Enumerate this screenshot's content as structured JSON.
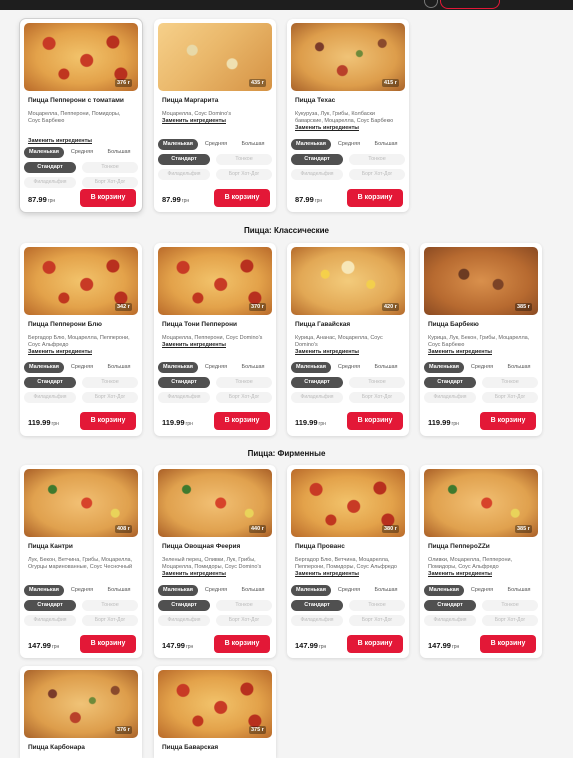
{
  "sections": [
    {
      "title": "",
      "cards": [
        {
          "name": "Пицца Пепперони с томатами",
          "weight": "376 г",
          "ingredients": "Моцарелла, Пепперони, Помидоры, Соус Барбекю",
          "change": "Заменить ингредиенты",
          "price": "87.99",
          "currency": "грн",
          "cart": "В корзину",
          "selected": true
        },
        {
          "name": "Пицца Маргарита",
          "weight": "435 г",
          "ingredients": "Моцарелла, Соус Domino's",
          "change": "Заменить ингредиенты",
          "price": "87.99",
          "currency": "грн",
          "cart": "В корзину"
        },
        {
          "name": "Пицца Техас",
          "weight": "415 г",
          "ingredients": "Кукуруза, Лук, Грибы, Колбаски баварские, Моцарелла, Соус Барбекю",
          "change": "Заменить ингредиенты",
          "price": "87.99",
          "currency": "грн",
          "cart": "В корзину"
        }
      ]
    },
    {
      "title": "Пицца: Классические",
      "cards": [
        {
          "name": "Пицца Пепперони Блю",
          "weight": "342 г",
          "ingredients": "Бергадор Блю, Моцарелла, Пепперони, Соус Альфредо",
          "change": "Заменить ингредиенты",
          "price": "119.99",
          "currency": "грн",
          "cart": "В корзину"
        },
        {
          "name": "Пицца Тони Пепперони",
          "weight": "370 г",
          "ingredients": "Моцарелла, Пепперони, Соус Domino's",
          "change": "Заменить ингредиенты",
          "price": "119.99",
          "currency": "грн",
          "cart": "В корзину"
        },
        {
          "name": "Пицца Гавайская",
          "weight": "420 г",
          "ingredients": "Курица, Ананас, Моцарелла, Соус Domino's",
          "change": "Заменить ингредиенты",
          "price": "119.99",
          "currency": "грн",
          "cart": "В корзину"
        },
        {
          "name": "Пицца Барбекю",
          "weight": "385 г",
          "ingredients": "Курица, Лук, Бекон, Грибы, Моцарелла, Соус Барбекю",
          "change": "Заменить ингредиенты",
          "price": "119.99",
          "currency": "грн",
          "cart": "В корзину"
        }
      ]
    },
    {
      "title": "Пицца: Фирменные",
      "cards": [
        {
          "name": "Пицца Кантри",
          "weight": "408 г",
          "ingredients": "Лук, Бекон, Ветчина, Грибы, Моцарелла, Огурцы маринованные, Соус Чесночный",
          "change": "",
          "price": "147.99",
          "currency": "грн",
          "cart": "В корзину"
        },
        {
          "name": "Пицца Овощная Феерия",
          "weight": "440 г",
          "ingredients": "Зеленый перец, Оливки, Лук, Грибы, Моцарелла, Помидоры, Соус Domino's",
          "change": "Заменить ингредиенты",
          "price": "147.99",
          "currency": "грн",
          "cart": "В корзину"
        },
        {
          "name": "Пицца Прованс",
          "weight": "380 г",
          "ingredients": "Бергадор Блю, Ветчина, Моцарелла, Пепперони, Помидоры, Соус Альфредо",
          "change": "Заменить ингредиенты",
          "price": "147.99",
          "currency": "грн",
          "cart": "В корзину"
        },
        {
          "name": "Пицца ПеппероZZи",
          "weight": "385 г",
          "ingredients": "Оливки, Моцарелла, Пепперони, Помидоры, Соус Альфредо",
          "change": "Заменить ингредиенты",
          "price": "147.99",
          "currency": "грн",
          "cart": "В корзину"
        }
      ]
    },
    {
      "title": "",
      "cards": [
        {
          "name": "Пицца Карбонара",
          "weight": "376 г"
        },
        {
          "name": "Пицца Баварская",
          "weight": "375 г"
        }
      ]
    }
  ],
  "options": {
    "sizes": [
      "Маленькая",
      "Средняя",
      "Большая"
    ],
    "crusts": [
      "Стандарт",
      "Тонкое"
    ],
    "extras": [
      "Филадельфия",
      "Борт Хот-Дог"
    ]
  },
  "colors": {
    "accent": "#e31837",
    "chip_active": "#505050",
    "background": "#f4f4f4"
  }
}
